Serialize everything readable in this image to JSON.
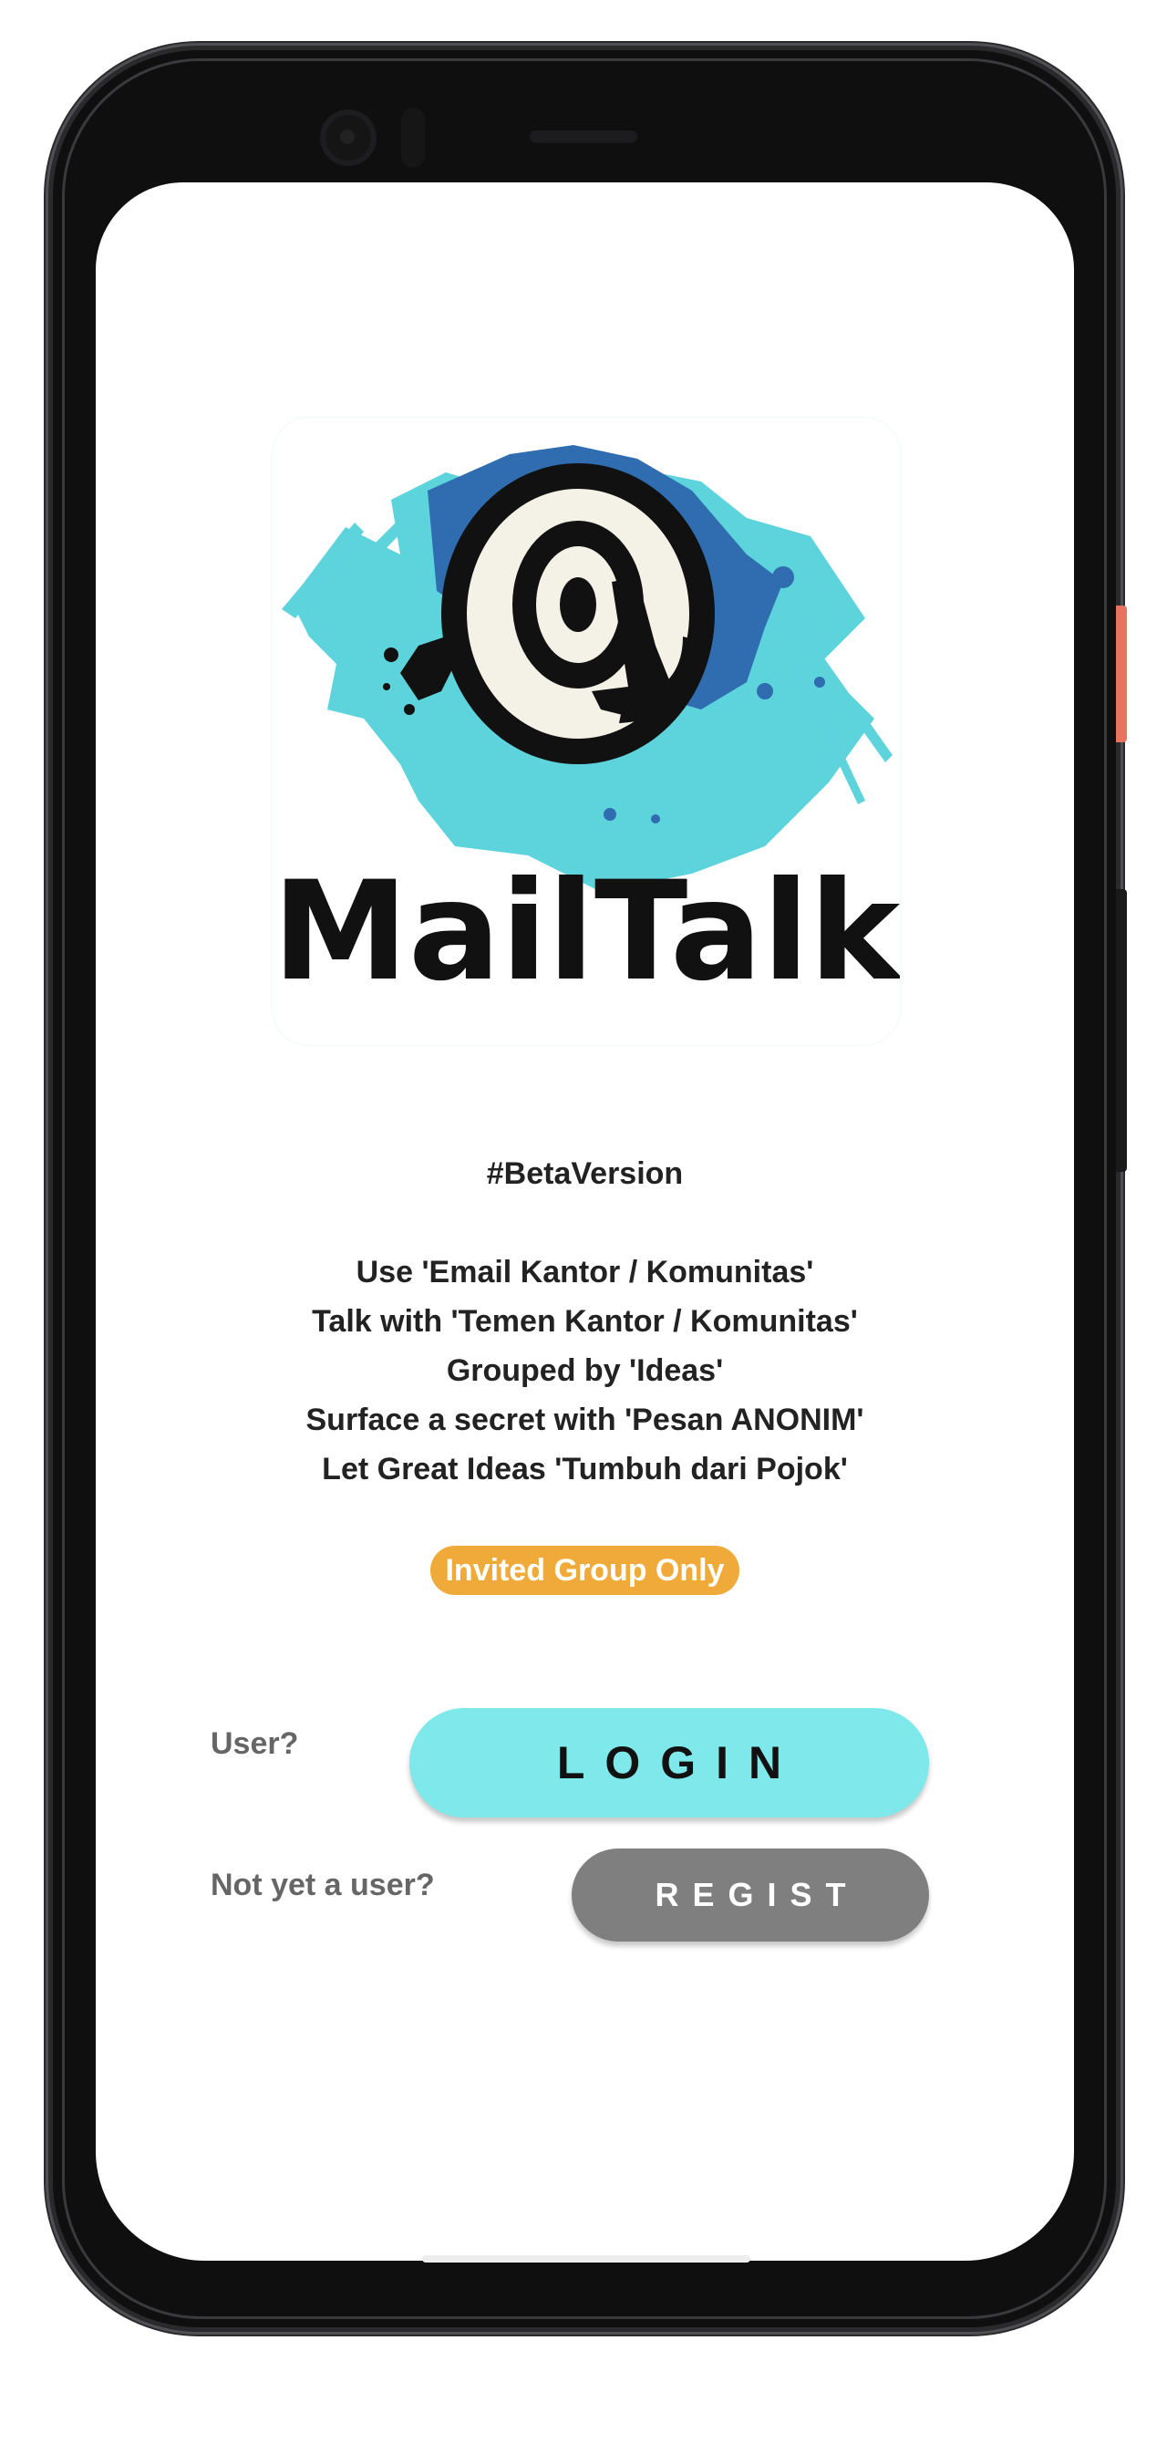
{
  "app": {
    "name": "MailTalk",
    "logo_text": "MailTalk"
  },
  "intro": {
    "beta_tag": "#BetaVersion",
    "lines": [
      "Use 'Email Kantor / Komunitas'",
      "Talk with 'Temen Kantor / Komunitas'",
      "Grouped by 'Ideas'",
      "Surface a secret with 'Pesan ANONIM'",
      "Let Great Ideas 'Tumbuh dari Pojok'"
    ],
    "badge": "Invited Group Only"
  },
  "auth": {
    "user_prompt": "User?",
    "login_label": "LOGIN",
    "new_user_prompt": "Not yet a user?",
    "regist_label": "REGIST"
  },
  "colors": {
    "login_button": "#7ee8ea",
    "regist_button": "#7f7f7f",
    "badge": "#f0aa3a",
    "logo_splash_cyan": "#5dd3dc",
    "logo_splash_blue": "#2f6db0"
  }
}
